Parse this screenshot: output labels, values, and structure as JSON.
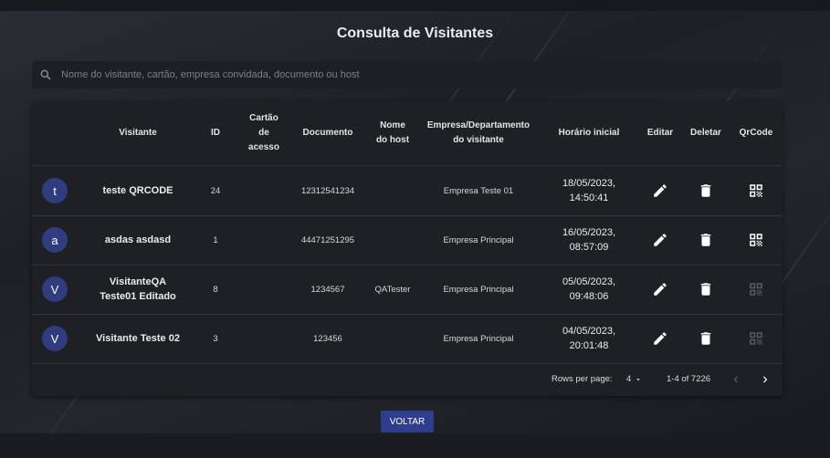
{
  "page_title": "Consulta de Visitantes",
  "search": {
    "placeholder": "Nome do visitante, cartão, empresa convidada, documento ou host",
    "value": ""
  },
  "table": {
    "headers": {
      "visitante": "Visitante",
      "id": "ID",
      "cartao_l1": "Cartão",
      "cartao_l2": "de",
      "cartao_l3": "acesso",
      "documento": "Documento",
      "host_l1": "Nome",
      "host_l2": "do host",
      "empresa_l1": "Empresa/Departamento",
      "empresa_l2": "do visitante",
      "horario": "Horário inicial",
      "editar": "Editar",
      "deletar": "Deletar",
      "qrcode": "QrCode"
    },
    "rows": [
      {
        "initial": "t",
        "name_l1": "teste QRCODE",
        "name_l2": "",
        "id": "24",
        "cartao": "",
        "documento": "12312541234",
        "host": "",
        "empresa": "Empresa Teste 01",
        "date": "18/05/2023,",
        "time": "14:50:41",
        "qrcode_enabled": true
      },
      {
        "initial": "a",
        "name_l1": "asdas asdasd",
        "name_l2": "",
        "id": "1",
        "cartao": "",
        "documento": "44471251295",
        "host": "",
        "empresa": "Empresa Principal",
        "date": "16/05/2023,",
        "time": "08:57:09",
        "qrcode_enabled": true
      },
      {
        "initial": "V",
        "name_l1": "VisitanteQA",
        "name_l2": "Teste01 Editado",
        "id": "8",
        "cartao": "",
        "documento": "1234567",
        "host": "QATester",
        "empresa": "Empresa Principal",
        "date": "05/05/2023,",
        "time": "09:48:06",
        "qrcode_enabled": false
      },
      {
        "initial": "V",
        "name_l1": "Visitante Teste 02",
        "name_l2": "",
        "id": "3",
        "cartao": "",
        "documento": "123456",
        "host": "",
        "empresa": "Empresa Principal",
        "date": "04/05/2023,",
        "time": "20:01:48",
        "qrcode_enabled": false
      }
    ]
  },
  "pagination": {
    "rows_per_page_label": "Rows per page:",
    "rows_per_page_value": "4",
    "range": "1-4 of 7226"
  },
  "voltar_button": "VOLTAR",
  "icons": {
    "search": "search-icon",
    "edit": "pencil-icon",
    "delete": "trash-icon",
    "qrcode": "qrcode-icon",
    "prev": "chevron-left-icon",
    "next": "chevron-right-icon",
    "dropdown": "caret-down-icon"
  },
  "colors": {
    "accent": "#2e3e8c",
    "avatar": "#2f3d80",
    "card": "#1e2023",
    "qr_disabled": "#5a5c60"
  }
}
